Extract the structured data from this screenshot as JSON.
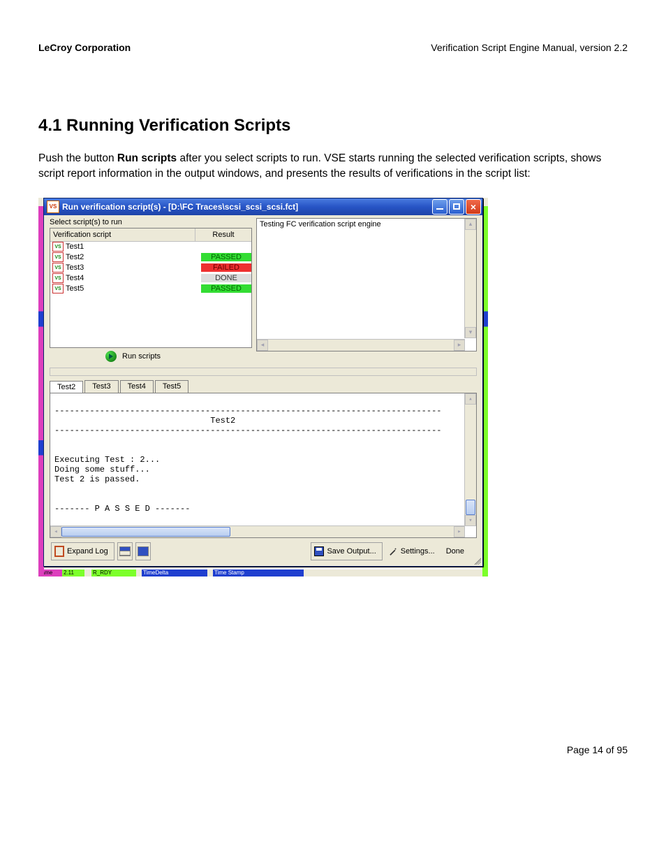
{
  "header": {
    "left": "LeCroy Corporation",
    "right": "Verification Script Engine Manual, version 2.2"
  },
  "section": {
    "title": "4.1    Running Verification Scripts",
    "text_pre": "Push the button ",
    "text_bold": "Run scripts",
    "text_post": " after you select scripts to run. VSE starts running the selected verification scripts, shows script report information in the output windows, and presents the results of verifications in the script list:"
  },
  "window": {
    "title": "Run verification script(s) - [D:\\FC Traces\\scsi_scsi_scsi.fct]",
    "select_label": "Select script(s) to run",
    "list_header_col1": "Verification script",
    "list_header_col2": "Result",
    "scripts": [
      {
        "name": "Test1",
        "result": ""
      },
      {
        "name": "Test2",
        "result": "PASSED"
      },
      {
        "name": "Test3",
        "result": "FAILED"
      },
      {
        "name": "Test4",
        "result": "DONE"
      },
      {
        "name": "Test5",
        "result": "PASSED"
      }
    ],
    "right_text": "Testing FC verification script engine",
    "run_label": "Run scripts",
    "tabs": [
      "Test2",
      "Test3",
      "Test4",
      "Test5"
    ],
    "output_text": "\n-----------------------------------------------------------------------------\n                               Test2\n-----------------------------------------------------------------------------\n\n\nExecuting Test : 2...\nDoing some stuff...\nTest 2 is passed.\n\n\n------- P A S S E D -------",
    "buttons": {
      "expand": "Expand Log",
      "save": "Save Output...",
      "settings": "Settings...",
      "done": "Done"
    }
  },
  "decor": {
    "frame": "rame",
    "rrdy": "R_RDY",
    "timedelta": "TimeDelta",
    "timestamp": "Time Stamp"
  },
  "footer": "Page 14 of 95"
}
